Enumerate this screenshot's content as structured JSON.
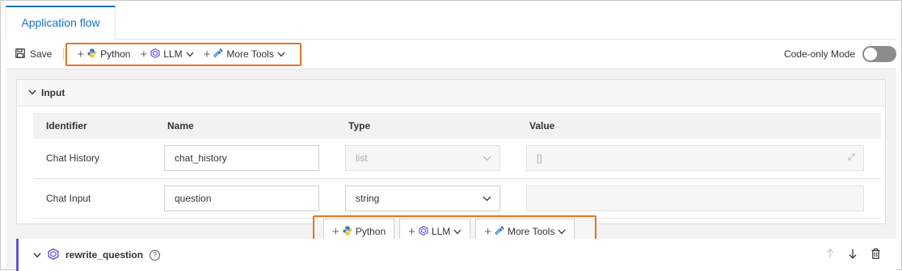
{
  "tabs": [
    {
      "label": "Application flow"
    }
  ],
  "toolbar": {
    "save_label": "Save",
    "python_label": "Python",
    "llm_label": "LLM",
    "more_tools_label": "More Tools",
    "code_only_label": "Code-only Mode",
    "code_only_enabled": false
  },
  "input_section": {
    "title": "Input",
    "columns": [
      "Identifier",
      "Name",
      "Type",
      "Value"
    ],
    "rows": [
      {
        "identifier": "Chat History",
        "name": "chat_history",
        "type": "list",
        "value": "[]",
        "disabled": true
      },
      {
        "identifier": "Chat Input",
        "name": "question",
        "type": "string",
        "value": "",
        "disabled": false
      }
    ]
  },
  "add_bar": {
    "python_label": "Python",
    "llm_label": "LLM",
    "more_tools_label": "More Tools"
  },
  "node": {
    "title": "rewrite_question",
    "help_icon": "?",
    "accent_color": "#6b4fe0"
  },
  "colors": {
    "primary": "#1670c7",
    "highlight": "#e8731c"
  },
  "icons": [
    "save-icon",
    "python-icon",
    "llm-icon",
    "wrench-icon",
    "chevron-down-icon",
    "arrow-up-icon",
    "arrow-down-icon",
    "trash-icon",
    "expand-icon"
  ]
}
